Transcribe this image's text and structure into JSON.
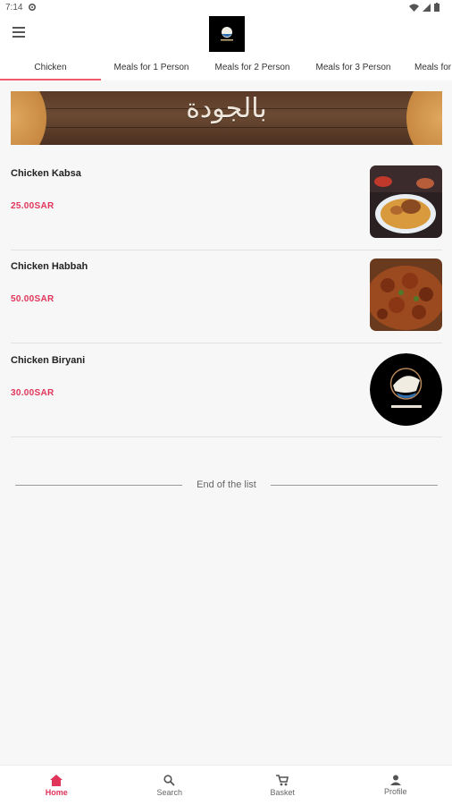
{
  "status_bar": {
    "time": "7:14"
  },
  "tabs": [
    {
      "label": "Chicken",
      "active": true
    },
    {
      "label": "Meals for 1 Person"
    },
    {
      "label": "Meals for 2 Person"
    },
    {
      "label": "Meals for 3 Person"
    },
    {
      "label": "Meals for"
    }
  ],
  "banner": {
    "text": "بالجودة"
  },
  "items": [
    {
      "name": "Chicken Kabsa",
      "price": "25.00SAR",
      "image": "kabsa-photo"
    },
    {
      "name": "Chicken Habbah",
      "price": "50.00SAR",
      "image": "habbah-photo"
    },
    {
      "name": "Chicken Biryani",
      "price": "30.00SAR",
      "image": "logo-placeholder"
    }
  ],
  "end_of_list": "End of the list",
  "bottom_nav": [
    {
      "label": "Home",
      "icon": "home-icon",
      "active": true
    },
    {
      "label": "Search",
      "icon": "search-icon"
    },
    {
      "label": "Basket",
      "icon": "cart-icon"
    },
    {
      "label": "Profile",
      "icon": "person-icon"
    }
  ],
  "colors": {
    "accent": "#e0345a",
    "tab_indicator": "#f05a6a"
  }
}
